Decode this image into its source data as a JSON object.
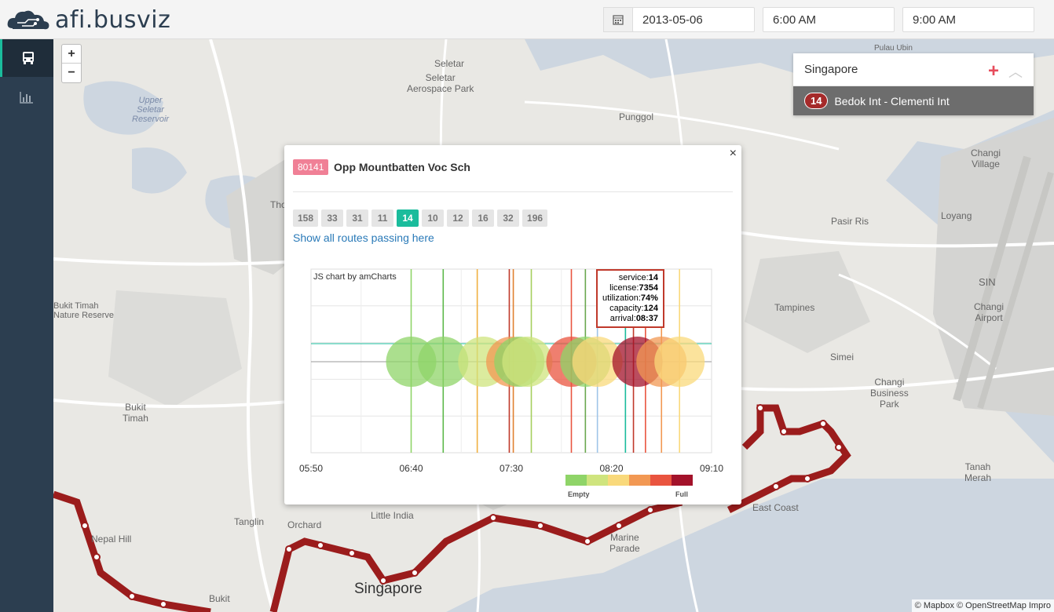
{
  "app": {
    "title": "afi.busviz"
  },
  "header": {
    "date": "2013-05-06",
    "start_time": "6:00 AM",
    "end_time": "9:00 AM"
  },
  "sidebar": {
    "items": [
      {
        "icon": "bus-icon"
      },
      {
        "icon": "bar-chart-icon"
      }
    ]
  },
  "map": {
    "zoom_in": "+",
    "zoom_out": "−",
    "labels": {
      "seletar": "Seletar",
      "seletar_aero": "Seletar\nAerospace Park",
      "punggol": "Punggol",
      "upper_seletar": "Upper\nSeletar\nReservoir",
      "pulau_ubin": "Pulau Ubin",
      "changi_village": "Changi\nVillage",
      "loyang": "Loyang",
      "pasir_ris": "Pasir Ris",
      "tampines": "Tampines",
      "sin": "SIN",
      "changi_airport": "Changi\nAirport",
      "simei": "Simei",
      "changi_business": "Changi\nBusiness\nPark",
      "tanah_merah": "Tanah\nMerah",
      "east_coast": "East Coast",
      "singapore": "Singapore",
      "little_india": "Little India",
      "orchard": "Orchard",
      "tanglin": "Tanglin",
      "bukit_timah": "Bukit\nTimah",
      "bukit_timah_reserve": "Bukit Timah\nNature Reserve",
      "bukit": "Bukit",
      "marine_parade": "Marine\nParade",
      "nepal_hill": "Nepal Hill",
      "tho": "Tho"
    }
  },
  "route_panel": {
    "region": "Singapore",
    "route_number": "14",
    "route_name": "Bedok Int - Clementi Int"
  },
  "popup": {
    "close": "×",
    "stop_code": "80141",
    "stop_name": "Opp Mountbatten Voc Sch",
    "services": [
      "158",
      "33",
      "31",
      "11",
      "14",
      "10",
      "12",
      "16",
      "32",
      "196"
    ],
    "active_service": "14",
    "show_all_link": "Show all routes passing here",
    "chart_credit": "JS chart by amCharts"
  },
  "chart_data": {
    "type": "scatter",
    "x_axis": {
      "min": "05:50",
      "max": "09:10",
      "ticks": [
        "05:50",
        "06:40",
        "07:30",
        "08:20",
        "09:10"
      ]
    },
    "tooltip": {
      "service": "14",
      "license": "7354",
      "utilization": "74%",
      "capacity": "124",
      "arrival": "08:37"
    },
    "legend": {
      "colors": [
        "#8fd468",
        "#cfe47e",
        "#f9d97b",
        "#f29853",
        "#e9543f",
        "#a3122a"
      ],
      "min_label": "Empty",
      "max_label": "Full"
    },
    "points": [
      {
        "time": "06:40",
        "utilization": 0.1
      },
      {
        "time": "06:56",
        "utilization": 0.12
      },
      {
        "time": "07:16",
        "utilization": 0.3
      },
      {
        "time": "07:30",
        "utilization": 0.6
      },
      {
        "time": "07:34",
        "utilization": 0.05
      },
      {
        "time": "07:38",
        "utilization": 0.2
      },
      {
        "time": "08:00",
        "utilization": 0.7
      },
      {
        "time": "08:07",
        "utilization": 0.15
      },
      {
        "time": "08:13",
        "utilization": 0.45
      },
      {
        "time": "08:33",
        "utilization": 0.95
      },
      {
        "time": "08:45",
        "utilization": 0.65
      },
      {
        "time": "08:54",
        "utilization": 0.35
      }
    ],
    "vlines": [
      {
        "time": "06:40",
        "color": "#8fd468"
      },
      {
        "time": "06:56",
        "color": "#5cb84a"
      },
      {
        "time": "07:13",
        "color": "#f0b040"
      },
      {
        "time": "07:29",
        "color": "#c0392b"
      },
      {
        "time": "07:31",
        "color": "#e08030"
      },
      {
        "time": "07:40",
        "color": "#a5cf5e"
      },
      {
        "time": "08:00",
        "color": "#e9543f"
      },
      {
        "time": "08:07",
        "color": "#6aa84f"
      },
      {
        "time": "08:13",
        "color": "#9fc5e8"
      },
      {
        "time": "08:27",
        "color": "#1abc9c"
      },
      {
        "time": "08:31",
        "color": "#c0392b"
      },
      {
        "time": "08:37",
        "color": "#e9543f"
      },
      {
        "time": "08:45",
        "color": "#f29853"
      },
      {
        "time": "08:54",
        "color": "#f9d97b"
      }
    ]
  },
  "attribution": "© Mapbox © OpenStreetMap Impro"
}
